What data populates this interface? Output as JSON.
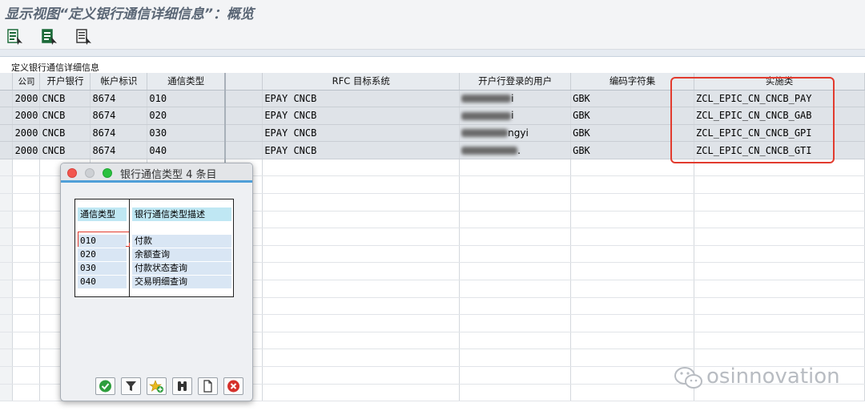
{
  "window": {
    "title": "显示视图“定义银行通信详细信息”：概览"
  },
  "toolbar": {
    "icons": [
      "details-view-icon",
      "select-all-icon",
      "print-preview-icon"
    ]
  },
  "grid": {
    "title": "定义银行通信详细信息",
    "columns": [
      "公司",
      "开户银行",
      "帐户标识",
      "通信类型",
      "",
      "RFC 目标系统",
      "开户行登录的用户",
      "编码字符集",
      "实施类"
    ],
    "rows": [
      {
        "company": "2000",
        "bank": "CNCB",
        "account": "8674",
        "comm_type": "010",
        "rfc": "EPAY CNCB",
        "user_tail": "i",
        "charset": "GBK",
        "impl_class": "ZCL_EPIC_CN_CNCB_PAY"
      },
      {
        "company": "2000",
        "bank": "CNCB",
        "account": "8674",
        "comm_type": "020",
        "rfc": "EPAY CNCB",
        "user_tail": "i",
        "charset": "GBK",
        "impl_class": "ZCL_EPIC_CN_CNCB_GAB"
      },
      {
        "company": "2000",
        "bank": "CNCB",
        "account": "8674",
        "comm_type": "030",
        "rfc": "EPAY CNCB",
        "user_tail": "ngyi",
        "charset": "GBK",
        "impl_class": "ZCL_EPIC_CN_CNCB_GPI"
      },
      {
        "company": "2000",
        "bank": "CNCB",
        "account": "8674",
        "comm_type": "040",
        "rfc": "EPAY CNCB",
        "user_tail": ".",
        "charset": "GBK",
        "impl_class": "ZCL_EPIC_CN_CNCB_GTI"
      }
    ]
  },
  "popup": {
    "title": "银行通信类型 4 条目",
    "header_type": "通信类型",
    "header_desc": "银行通信类型描述",
    "entries": [
      {
        "code": "010",
        "desc": "付款"
      },
      {
        "code": "020",
        "desc": "余额查询"
      },
      {
        "code": "030",
        "desc": "付款状态查询"
      },
      {
        "code": "040",
        "desc": "交易明细查询"
      }
    ],
    "buttons": [
      "confirm-icon",
      "filter-icon",
      "favorite-add-icon",
      "find-icon",
      "new-document-icon",
      "cancel-icon"
    ]
  },
  "colors": {
    "highlight": "#e23b2e",
    "popup_accent": "#4f9fd8",
    "traffic_red": "#f2574f",
    "traffic_gray": "#cdd0d4",
    "traffic_green": "#2ac13f"
  },
  "watermark": {
    "text": "osinnovation"
  }
}
